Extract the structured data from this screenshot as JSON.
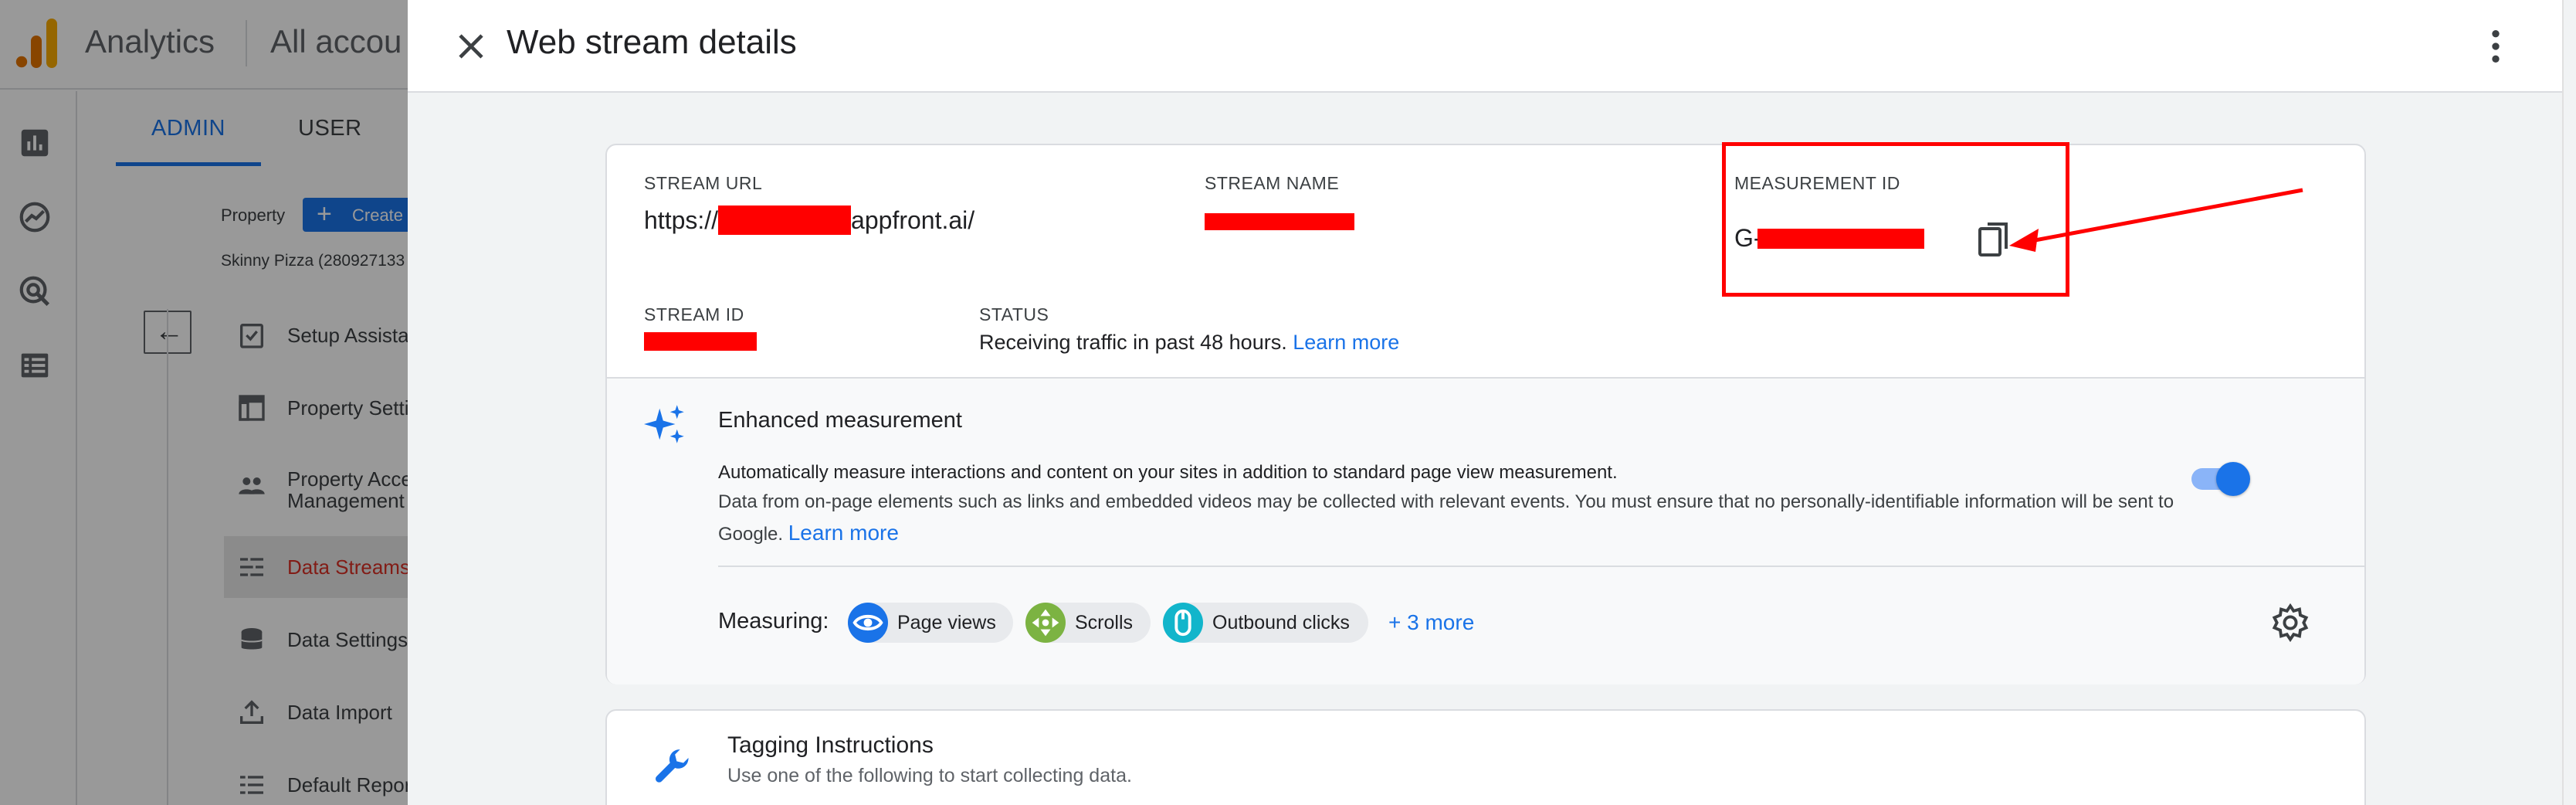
{
  "background": {
    "app_name": "Analytics",
    "account": "All accou",
    "tabs": [
      {
        "label": "ADMIN"
      },
      {
        "label": "USER"
      }
    ],
    "property_label": "Property",
    "create_label": "Create",
    "property_name": "Skinny Pizza (280927133",
    "menu": [
      {
        "label": "Setup Assista"
      },
      {
        "label": "Property Setti"
      },
      {
        "label": "Property Acce\nManagement"
      },
      {
        "label": "Data Streams"
      },
      {
        "label": "Data Settings"
      },
      {
        "label": "Data Import"
      },
      {
        "label": "Default Repor"
      }
    ]
  },
  "drawer": {
    "title": "Web stream details",
    "stream_url": {
      "label": "STREAM URL",
      "prefix": "https://",
      "suffix": "appfront.ai/"
    },
    "stream_name": {
      "label": "STREAM NAME"
    },
    "measurement_id": {
      "label": "MEASUREMENT ID",
      "prefix": "G-"
    },
    "stream_id": {
      "label": "STREAM ID"
    },
    "status": {
      "label": "STATUS",
      "text": "Receiving traffic in past 48 hours.",
      "link": "Learn more"
    },
    "enhanced": {
      "title": "Enhanced measurement",
      "desc_bold": "Automatically measure interactions and content on your sites in addition to standard page view measurement.",
      "desc_line2": "Data from on-page elements such as links and embedded videos may be collected with relevant events. You must ensure that no personally-identifiable information will be sent to",
      "desc_line3": "Google.",
      "learn_more": "Learn more",
      "toggle_on": true
    },
    "measuring": {
      "label": "Measuring:",
      "chips": [
        {
          "label": "Page views",
          "icon": "eye-icon",
          "color": "#1a73e8"
        },
        {
          "label": "Scrolls",
          "icon": "scroll-icon",
          "color": "#7cb342"
        },
        {
          "label": "Outbound clicks",
          "icon": "mouse-icon",
          "color": "#12b5cb"
        }
      ],
      "more": "+ 3 more"
    },
    "tagging": {
      "title": "Tagging Instructions",
      "subtitle": "Use one of the following to start collecting data."
    }
  },
  "colors": {
    "accent": "#1a73e8",
    "annotation": "#ff0000",
    "active_menu": "#d93025"
  }
}
